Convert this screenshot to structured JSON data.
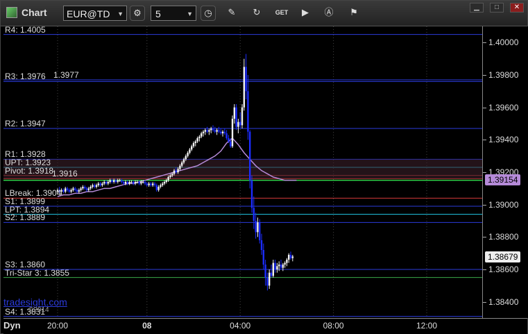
{
  "window": {
    "title": "Chart",
    "symbol": "EUR@TD",
    "period": "5",
    "tools": [
      "settings-icon",
      "clock-icon",
      "pencil-icon",
      "refresh-icon",
      "get-icon",
      "play-icon",
      "alert-icon",
      "flag-icon"
    ],
    "controls": [
      "minimize",
      "maximize",
      "close"
    ]
  },
  "levels": [
    {
      "label": "R4: 1.4005",
      "price": 1.4005,
      "color": "#2b3bdc"
    },
    {
      "label": "R3: 1.3976",
      "price": 1.3976,
      "color": "#2b3bdc"
    },
    {
      "label": "1.3977",
      "price": 1.3977,
      "color": "#2b3bdc"
    },
    {
      "label": "R2: 1.3947",
      "price": 1.3947,
      "color": "#2b3bdc"
    },
    {
      "label": "R1: 1.3928",
      "price": 1.3928,
      "color": "#2b3bdc"
    },
    {
      "label": "UPT: 1.3923",
      "price": 1.3923,
      "color": "#22c8e6"
    },
    {
      "label": "Pivot: 1.3918",
      "price": 1.3918,
      "color": "#d43a3a"
    },
    {
      "label": "1.3916",
      "price": 1.3916,
      "color": "#d43a3a"
    },
    {
      "label": "LBreak: 1.3904",
      "price": 1.3904,
      "color": "#d43a3a"
    },
    {
      "label": "S1: 1.3899",
      "price": 1.3899,
      "color": "#2b3bdc"
    },
    {
      "label": "LPT: 1.3894",
      "price": 1.3894,
      "color": "#22c8e6"
    },
    {
      "label": "S2: 1.3889",
      "price": 1.3889,
      "color": "#2b3bdc"
    },
    {
      "label": "S3: 1.3860",
      "price": 1.386,
      "color": "#2b3bdc"
    },
    {
      "label": "Tri-Star 3: 1.3855",
      "price": 1.3855,
      "color": "#3aa84a"
    },
    {
      "label": "S4: 1.3831",
      "price": 1.3831,
      "color": "#2b3bdc"
    }
  ],
  "green_level": {
    "price": 1.3915,
    "color": "#2fd74a"
  },
  "watermark": "tradesight.com",
  "copyright": "©2014",
  "chart_data": {
    "type": "candlestick",
    "ylim": [
      1.383,
      1.401
    ],
    "yticks": [
      "1.40000",
      "1.39800",
      "1.39600",
      "1.39400",
      "1.39200",
      "1.39000",
      "1.38800",
      "1.38600",
      "1.38400"
    ],
    "ytick_values": [
      1.4,
      1.398,
      1.396,
      1.394,
      1.392,
      1.39,
      1.388,
      1.386,
      1.384
    ],
    "xticks": [
      {
        "label": "20:00",
        "bar": 0
      },
      {
        "label": "08",
        "bar": 46
      },
      {
        "label": "04:00",
        "bar": 94
      },
      {
        "label": "08:00",
        "bar": 142
      },
      {
        "label": "12:00",
        "bar": 190
      }
    ],
    "last_price": {
      "label": "1.38679",
      "value": 1.38679,
      "color": "#eeeeee"
    },
    "ma_price": {
      "label": "1.39154",
      "value": 1.39154,
      "color": "#b58ad8"
    },
    "candles": [
      [
        1.3908,
        1.391,
        1.3907,
        1.3909
      ],
      [
        1.3909,
        1.3911,
        1.3907,
        1.3908
      ],
      [
        1.3908,
        1.391,
        1.3906,
        1.3909
      ],
      [
        1.3909,
        1.391,
        1.3907,
        1.3908
      ],
      [
        1.3908,
        1.3911,
        1.3907,
        1.391
      ],
      [
        1.391,
        1.3911,
        1.3908,
        1.3909
      ],
      [
        1.3909,
        1.391,
        1.3907,
        1.3908
      ],
      [
        1.3908,
        1.391,
        1.3907,
        1.3909
      ],
      [
        1.3909,
        1.3911,
        1.3908,
        1.391
      ],
      [
        1.391,
        1.3911,
        1.3908,
        1.3909
      ],
      [
        1.3909,
        1.391,
        1.3907,
        1.3908
      ],
      [
        1.3908,
        1.391,
        1.3907,
        1.3909
      ],
      [
        1.3909,
        1.3911,
        1.3908,
        1.391
      ],
      [
        1.391,
        1.3912,
        1.3909,
        1.3911
      ],
      [
        1.3911,
        1.3912,
        1.3909,
        1.391
      ],
      [
        1.391,
        1.3911,
        1.3908,
        1.3909
      ],
      [
        1.3909,
        1.3911,
        1.3908,
        1.391
      ],
      [
        1.391,
        1.3912,
        1.3909,
        1.3911
      ],
      [
        1.3911,
        1.3913,
        1.391,
        1.3912
      ],
      [
        1.3912,
        1.3913,
        1.391,
        1.3911
      ],
      [
        1.3911,
        1.3913,
        1.391,
        1.3912
      ],
      [
        1.3912,
        1.3914,
        1.3911,
        1.3913
      ],
      [
        1.3913,
        1.3914,
        1.3911,
        1.3912
      ],
      [
        1.3912,
        1.3914,
        1.3911,
        1.3913
      ],
      [
        1.3913,
        1.3915,
        1.3912,
        1.3914
      ],
      [
        1.3914,
        1.3915,
        1.3912,
        1.3913
      ],
      [
        1.3913,
        1.3915,
        1.3912,
        1.3914
      ],
      [
        1.3914,
        1.3916,
        1.3913,
        1.3915
      ],
      [
        1.3915,
        1.3916,
        1.3913,
        1.3914
      ],
      [
        1.3914,
        1.3916,
        1.3913,
        1.3915
      ],
      [
        1.3915,
        1.3916,
        1.3913,
        1.3914
      ],
      [
        1.3914,
        1.3916,
        1.3913,
        1.3915
      ],
      [
        1.3915,
        1.3916,
        1.3914,
        1.3915
      ],
      [
        1.3915,
        1.3916,
        1.3913,
        1.3914
      ],
      [
        1.3914,
        1.3915,
        1.3912,
        1.3913
      ],
      [
        1.3913,
        1.3915,
        1.3912,
        1.3914
      ],
      [
        1.3914,
        1.3915,
        1.3912,
        1.3913
      ],
      [
        1.3913,
        1.3915,
        1.3912,
        1.3914
      ],
      [
        1.3914,
        1.3915,
        1.3913,
        1.3914
      ],
      [
        1.3914,
        1.3915,
        1.3912,
        1.3913
      ],
      [
        1.3913,
        1.3915,
        1.3912,
        1.3914
      ],
      [
        1.3914,
        1.3915,
        1.3913,
        1.3914
      ],
      [
        1.3914,
        1.3915,
        1.3912,
        1.3913
      ],
      [
        1.3913,
        1.3915,
        1.3912,
        1.3914
      ],
      [
        1.3914,
        1.3915,
        1.3913,
        1.3914
      ],
      [
        1.3914,
        1.3915,
        1.3912,
        1.3913
      ],
      [
        1.3913,
        1.3914,
        1.3911,
        1.3912
      ],
      [
        1.3912,
        1.3914,
        1.3911,
        1.3913
      ],
      [
        1.3913,
        1.3914,
        1.3911,
        1.3912
      ],
      [
        1.3912,
        1.3914,
        1.3911,
        1.3913
      ],
      [
        1.3913,
        1.3914,
        1.3911,
        1.3912
      ],
      [
        1.3912,
        1.3913,
        1.3908,
        1.3909
      ],
      [
        1.3909,
        1.3912,
        1.3908,
        1.3911
      ],
      [
        1.3911,
        1.3913,
        1.391,
        1.3912
      ],
      [
        1.3912,
        1.3914,
        1.3911,
        1.3913
      ],
      [
        1.3913,
        1.3915,
        1.3912,
        1.3914
      ],
      [
        1.3914,
        1.3916,
        1.3913,
        1.3915
      ],
      [
        1.3915,
        1.3918,
        1.3914,
        1.3917
      ],
      [
        1.3917,
        1.3919,
        1.3916,
        1.3918
      ],
      [
        1.3918,
        1.392,
        1.3917,
        1.3919
      ],
      [
        1.3919,
        1.3922,
        1.3918,
        1.3921
      ],
      [
        1.3921,
        1.3923,
        1.3919,
        1.392
      ],
      [
        1.392,
        1.3923,
        1.3919,
        1.3922
      ],
      [
        1.3922,
        1.3925,
        1.3921,
        1.3924
      ],
      [
        1.3924,
        1.3927,
        1.3923,
        1.3926
      ],
      [
        1.3926,
        1.3929,
        1.3925,
        1.3928
      ],
      [
        1.3928,
        1.3931,
        1.3927,
        1.393
      ],
      [
        1.393,
        1.3933,
        1.3929,
        1.3932
      ],
      [
        1.3932,
        1.3935,
        1.3931,
        1.3934
      ],
      [
        1.3934,
        1.3937,
        1.3933,
        1.3936
      ],
      [
        1.3936,
        1.3939,
        1.3935,
        1.3938
      ],
      [
        1.3938,
        1.394,
        1.3936,
        1.3939
      ],
      [
        1.3939,
        1.3942,
        1.3938,
        1.3941
      ],
      [
        1.3941,
        1.3943,
        1.3939,
        1.3942
      ],
      [
        1.3942,
        1.3945,
        1.3941,
        1.3944
      ],
      [
        1.3944,
        1.3946,
        1.3942,
        1.3945
      ],
      [
        1.3945,
        1.3947,
        1.3943,
        1.3946
      ],
      [
        1.3946,
        1.3948,
        1.3944,
        1.3945
      ],
      [
        1.3945,
        1.3947,
        1.3943,
        1.3946
      ],
      [
        1.3946,
        1.3948,
        1.3944,
        1.3947
      ],
      [
        1.3947,
        1.3949,
        1.3945,
        1.3946
      ],
      [
        1.3946,
        1.3948,
        1.3944,
        1.3945
      ],
      [
        1.3945,
        1.3947,
        1.3943,
        1.3946
      ],
      [
        1.3946,
        1.3948,
        1.3944,
        1.3945
      ],
      [
        1.3945,
        1.3947,
        1.3943,
        1.3944
      ],
      [
        1.3944,
        1.3946,
        1.3942,
        1.3945
      ],
      [
        1.3945,
        1.3947,
        1.3943,
        1.3944
      ],
      [
        1.3944,
        1.3946,
        1.394,
        1.3941
      ],
      [
        1.3941,
        1.3943,
        1.3938,
        1.3939
      ],
      [
        1.3939,
        1.3941,
        1.3935,
        1.3936
      ],
      [
        1.3936,
        1.3955,
        1.3935,
        1.3953
      ],
      [
        1.3953,
        1.3962,
        1.395,
        1.396
      ],
      [
        1.396,
        1.3962,
        1.3946,
        1.3948
      ],
      [
        1.3948,
        1.3953,
        1.3944,
        1.3951
      ],
      [
        1.3951,
        1.3957,
        1.3947,
        1.3949
      ],
      [
        1.3949,
        1.3962,
        1.3947,
        1.396
      ],
      [
        1.396,
        1.399,
        1.3958,
        1.3985
      ],
      [
        1.3985,
        1.3993,
        1.3965,
        1.397
      ],
      [
        1.397,
        1.398,
        1.394,
        1.3945
      ],
      [
        1.3945,
        1.3946,
        1.391,
        1.3915
      ],
      [
        1.3915,
        1.3918,
        1.3895,
        1.3898
      ],
      [
        1.3898,
        1.3905,
        1.3885,
        1.389
      ],
      [
        1.389,
        1.3895,
        1.3879,
        1.3883
      ],
      [
        1.3883,
        1.3892,
        1.388,
        1.3889
      ],
      [
        1.3889,
        1.3891,
        1.3876,
        1.3878
      ],
      [
        1.3878,
        1.3882,
        1.3869,
        1.3872
      ],
      [
        1.3872,
        1.3876,
        1.386,
        1.3863
      ],
      [
        1.3863,
        1.3866,
        1.385,
        1.3855
      ],
      [
        1.3855,
        1.3858,
        1.3847,
        1.385
      ],
      [
        1.385,
        1.386,
        1.3848,
        1.3858
      ],
      [
        1.3858,
        1.3863,
        1.3855,
        1.3856
      ],
      [
        1.3856,
        1.3866,
        1.3855,
        1.3864
      ],
      [
        1.3864,
        1.3866,
        1.3858,
        1.386
      ],
      [
        1.386,
        1.3864,
        1.3858,
        1.3862
      ],
      [
        1.3862,
        1.3865,
        1.3859,
        1.3863
      ],
      [
        1.3863,
        1.3866,
        1.386,
        1.3861
      ],
      [
        1.3861,
        1.3864,
        1.3859,
        1.3863
      ],
      [
        1.3863,
        1.3865,
        1.3861,
        1.3864
      ],
      [
        1.3864,
        1.3867,
        1.3862,
        1.3866
      ],
      [
        1.3866,
        1.387,
        1.3864,
        1.3869
      ],
      [
        1.3869,
        1.3871,
        1.3866,
        1.3867
      ],
      [
        1.3867,
        1.3869,
        1.3865,
        1.3868
      ]
    ],
    "ma": [
      1.3905,
      1.3906,
      1.3906,
      1.3907,
      1.3907,
      1.3908,
      1.3908,
      1.3909,
      1.391,
      1.391,
      1.3911,
      1.3912,
      1.3913,
      1.3913,
      1.3914,
      1.3915,
      1.3916,
      1.3917,
      1.3918,
      1.3919,
      1.392,
      1.3921,
      1.3922,
      1.3923,
      1.3924,
      1.3926,
      1.3928,
      1.393,
      1.3933,
      1.3938,
      1.3941,
      1.3937,
      1.3932,
      1.3928,
      1.3924,
      1.3921,
      1.3919,
      1.3917,
      1.3916,
      1.3915,
      1.3915,
      1.3915
    ],
    "ma_start_bar": 0,
    "ma_step": 3
  }
}
